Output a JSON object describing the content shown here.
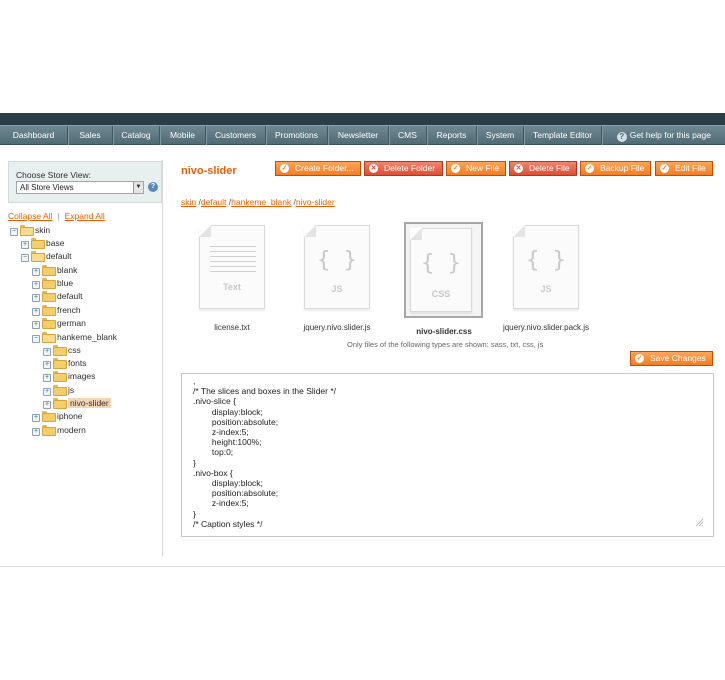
{
  "nav": {
    "items": [
      "Dashboard",
      "Sales",
      "Catalog",
      "Mobile",
      "Customers",
      "Promotions",
      "Newsletter",
      "CMS",
      "Reports",
      "System",
      "Template Editor"
    ],
    "help_label": "Get help for this page"
  },
  "sidebar": {
    "store_label": "Choose Store View:",
    "store_value": "All Store Views",
    "collapse_all": "Collapse All",
    "expand_all": "Expand All",
    "separator": "|",
    "tree": [
      {
        "label": "skin",
        "exp": "−"
      },
      {
        "label": "base",
        "exp": "+"
      },
      {
        "label": "default",
        "exp": "−"
      },
      {
        "label": "blank",
        "exp": "+"
      },
      {
        "label": "blue",
        "exp": "+"
      },
      {
        "label": "default",
        "exp": "+"
      },
      {
        "label": "french",
        "exp": "+"
      },
      {
        "label": "german",
        "exp": "+"
      },
      {
        "label": "hankeme_blank",
        "exp": "−"
      },
      {
        "label": "css",
        "exp": "+"
      },
      {
        "label": "fonts",
        "exp": "+"
      },
      {
        "label": "images",
        "exp": "+"
      },
      {
        "label": "js",
        "exp": "+"
      },
      {
        "label": "nivo-slider",
        "exp": "+"
      },
      {
        "label": "iphone",
        "exp": "+"
      },
      {
        "label": "modern",
        "exp": "+"
      }
    ]
  },
  "content": {
    "title": "nivo-slider",
    "buttons": {
      "create_folder": "Create Folder...",
      "delete_folder": "Delete Folder",
      "new_file": "New File",
      "delete_file": "Delete File",
      "backup_file": "Backup File",
      "edit_file": "Edit File"
    },
    "breadcrumb": [
      "skin",
      "default",
      "hankeme_blank",
      "nivo-slider"
    ],
    "breadcrumb_sep": "/",
    "files": [
      {
        "name": "license.txt",
        "type": "Text"
      },
      {
        "name": "jquery.nivo.slider.js",
        "type": "JS"
      },
      {
        "name": "nivo-slider.css",
        "type": "CSS"
      },
      {
        "name": "jquery.nivo.slider.pack.js",
        "type": "JS"
      }
    ],
    "braces": "{ }",
    "types_note": "Only files of the following types are shown: sass, txt, css, js",
    "save_label": "Save Changes",
    "editor_text": ",\n/* The slices and boxes in the Slider */\n.nivo-slice {\n        display:block;\n        position:absolute;\n        z-index:5;\n        height:100%;\n        top:0;\n}\n.nivo-box {\n        display:block;\n        position:absolute;\n        z-index:5;\n}\n/* Caption styles */"
  },
  "colors": {
    "accent": "#eb5e00",
    "button_orange": "#f47d21",
    "button_red": "#dd4d32",
    "nav_bg": "#5b7781"
  }
}
